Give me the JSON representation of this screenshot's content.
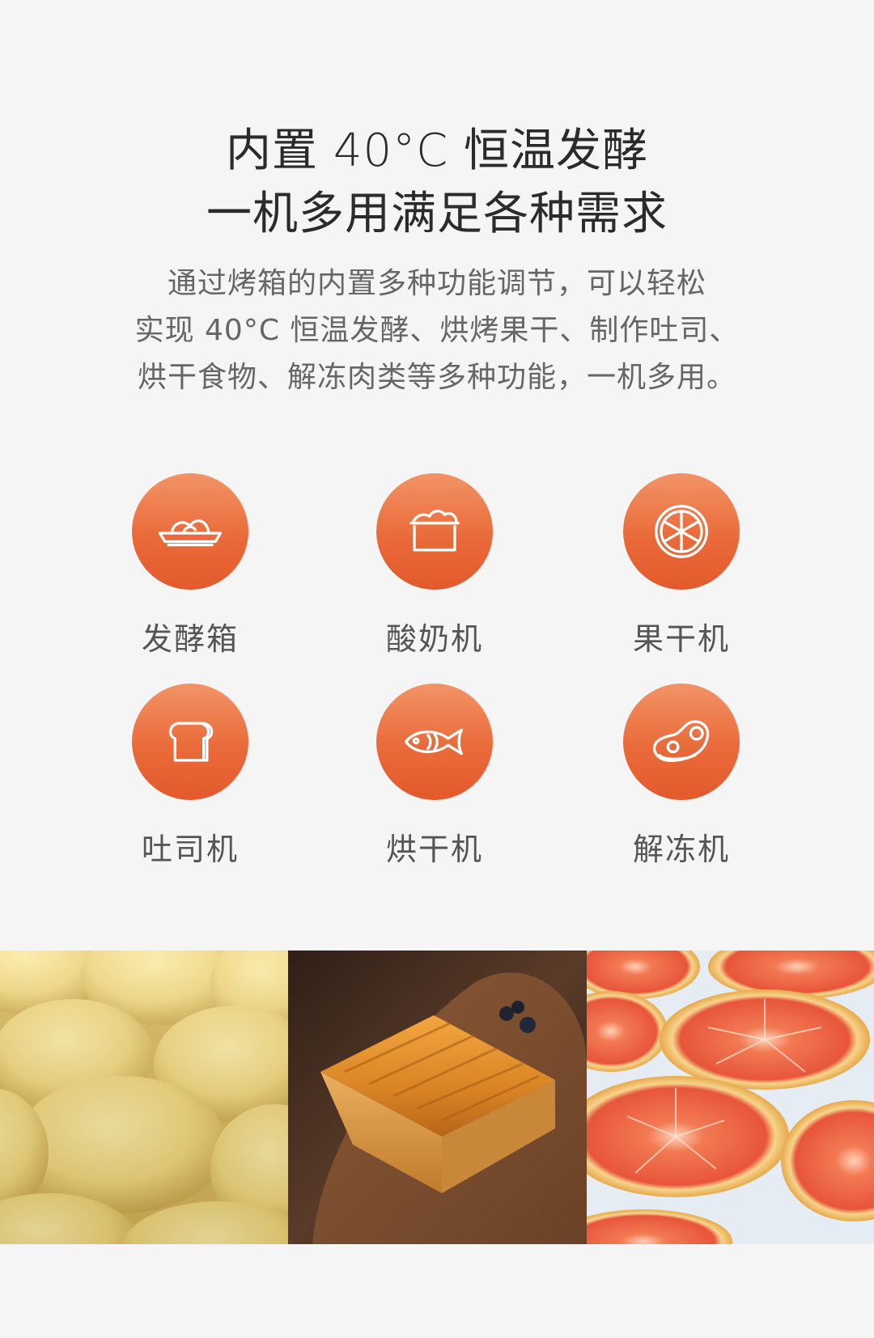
{
  "headline": {
    "line1": "内置 40°C 恒温发酵",
    "line2": "一机多用满足各种需求"
  },
  "description": {
    "line1": "通过烤箱的内置多种功能调节，可以轻松",
    "line2": "实现 40°C 恒温发酵、烘烤果干、制作吐司、",
    "line3": "烘干食物、解冻肉类等多种功能，一机多用。"
  },
  "features": [
    {
      "label": "发酵箱",
      "icon": "dough-bowl-icon"
    },
    {
      "label": "酸奶机",
      "icon": "yogurt-cup-icon"
    },
    {
      "label": "果干机",
      "icon": "citrus-slice-icon"
    },
    {
      "label": "吐司机",
      "icon": "toast-icon"
    },
    {
      "label": "烘干机",
      "icon": "fish-icon"
    },
    {
      "label": "解冻机",
      "icon": "meat-steak-icon"
    }
  ],
  "colors": {
    "background": "#f5f5f5",
    "accent_top": "#f29466",
    "accent_bottom": "#e35a2c"
  }
}
